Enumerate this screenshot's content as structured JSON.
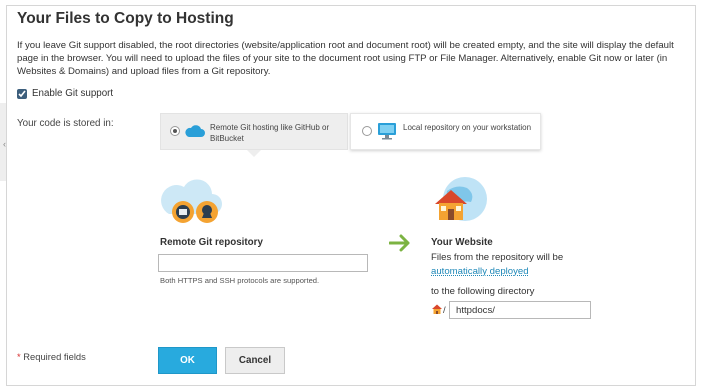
{
  "dialog": {
    "title": "Your Files to Copy to Hosting",
    "description": "If you leave Git support disabled, the root directories (website/application root and document root) will be created empty, and the site will display the default page in the browser. You will need to upload the files of your site to the document root using FTP or File Manager. Alternatively, enable Git now or later (in Websites & Domains) and upload files from a Git repository."
  },
  "git_support": {
    "label": "Enable Git support",
    "checked": true
  },
  "code_location": {
    "label": "Your code is stored in:",
    "options": [
      {
        "label": "Remote Git hosting like GitHub or BitBucket",
        "selected": true,
        "icon": "cloud-icon"
      },
      {
        "label": "Local repository on your workstation",
        "selected": false,
        "icon": "monitor-icon"
      }
    ]
  },
  "remote_repo": {
    "title": "Remote Git repository",
    "value": "",
    "hint": "Both HTTPS and SSH protocols are supported."
  },
  "website": {
    "title": "Your Website",
    "line1": "Files from the repository will be",
    "link": "automatically deployed",
    "line2": "to the following directory",
    "separator": "/",
    "directory": "httpdocs/"
  },
  "footer": {
    "required_star": "*",
    "required_text": "Required fields",
    "ok_label": "OK",
    "cancel_label": "Cancel"
  },
  "colors": {
    "accent": "#28aade",
    "link": "#1e88b8",
    "arrow": "#7cb342",
    "required": "#d62c2c"
  }
}
